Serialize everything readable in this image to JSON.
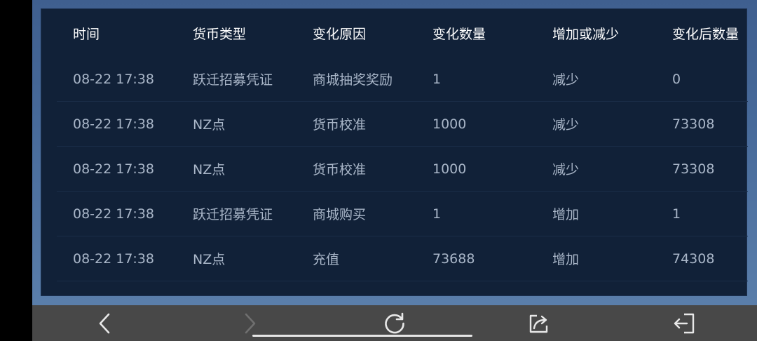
{
  "table": {
    "headers": [
      "时间",
      "货币类型",
      "变化原因",
      "变化数量",
      "增加或减少",
      "变化后数量"
    ],
    "rows": [
      [
        "08-22 17:38",
        "跃迁招募凭证",
        "商城抽奖奖励",
        "1",
        "减少",
        "0"
      ],
      [
        "08-22 17:38",
        "NZ点",
        "货币校准",
        "1000",
        "减少",
        "73308"
      ],
      [
        "08-22 17:38",
        "NZ点",
        "货币校准",
        "1000",
        "减少",
        "73308"
      ],
      [
        "08-22 17:38",
        "跃迁招募凭证",
        "商城购买",
        "1",
        "增加",
        "1"
      ],
      [
        "08-22 17:38",
        "NZ点",
        "充值",
        "73688",
        "增加",
        "74308"
      ]
    ]
  },
  "navbar": {
    "icons": [
      "back-arrow-icon",
      "forward-arrow-icon",
      "refresh-icon",
      "share-icon",
      "exit-icon"
    ],
    "forward_disabled": true
  },
  "colors": {
    "panel_bg": "#112138",
    "header_text": "#ffffff",
    "cell_text": "#a9b6c8",
    "navbar_bg": "#484848"
  }
}
